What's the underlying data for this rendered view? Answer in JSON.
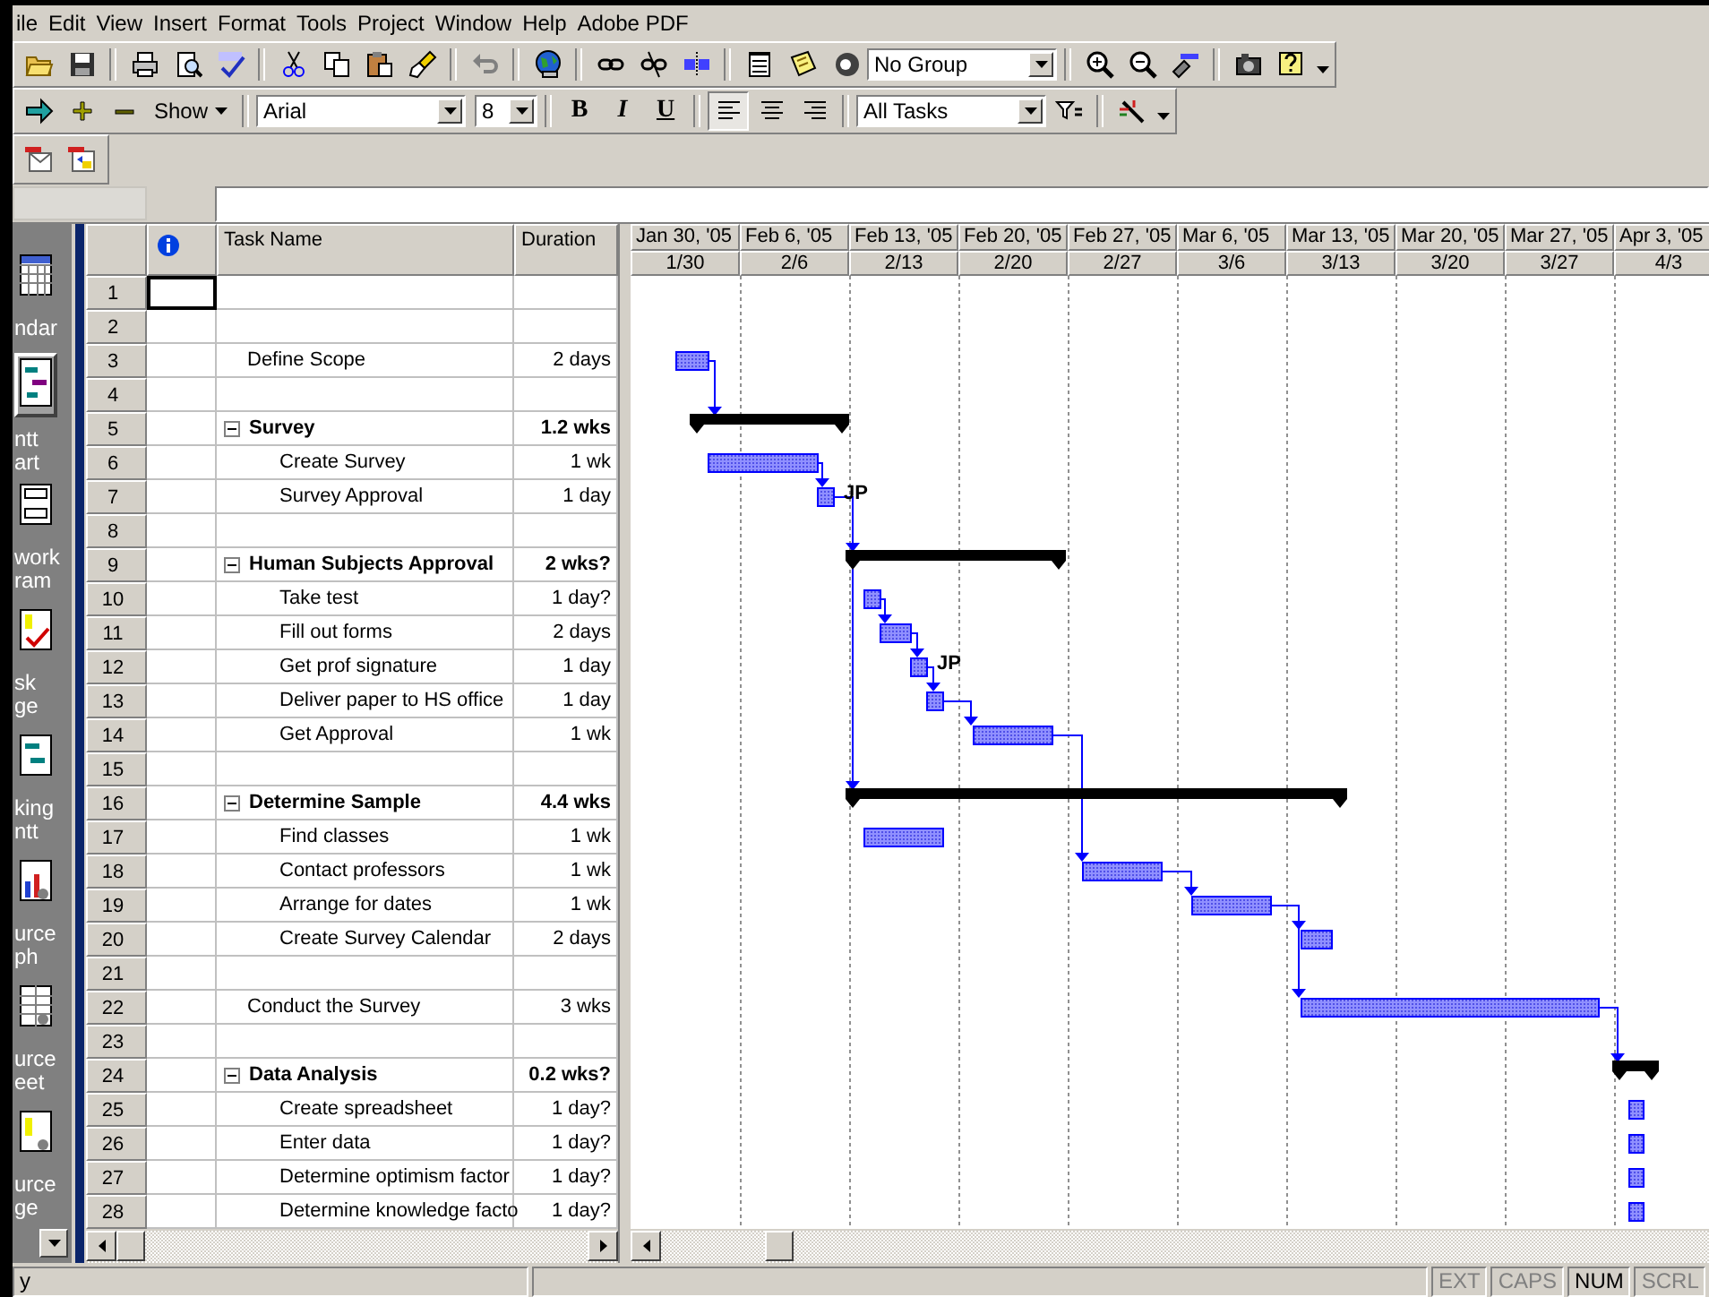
{
  "menu": [
    {
      "label": "ile"
    },
    {
      "label": "Edit"
    },
    {
      "label": "View"
    },
    {
      "label": "Insert"
    },
    {
      "label": "Format"
    },
    {
      "label": "Tools"
    },
    {
      "label": "Project"
    },
    {
      "label": "Window"
    },
    {
      "label": "Help"
    },
    {
      "label": "Adobe PDF"
    }
  ],
  "toolbar": {
    "undo": {
      "disabled": true
    },
    "group_dropdown": {
      "value": "No Group"
    },
    "show_button": {
      "label": "Show"
    },
    "font_dropdown": {
      "value": "Arial"
    },
    "size_dropdown": {
      "value": "8"
    },
    "style_buttons": [
      {
        "label": "B",
        "on": false
      },
      {
        "label": "I",
        "on": false
      },
      {
        "label": "U",
        "on": false
      }
    ],
    "align_buttons": [
      {
        "selected": true
      },
      {
        "selected": false
      },
      {
        "selected": false
      }
    ],
    "filter_dropdown": {
      "value": "All Tasks"
    }
  },
  "view_bar": {
    "items": [
      {
        "lines": [
          "ndar"
        ],
        "selected": false
      },
      {
        "lines": [
          "ntt",
          "art"
        ],
        "selected": true
      },
      {
        "lines": [
          "work",
          "ram"
        ],
        "selected": false
      },
      {
        "lines": [
          "sk",
          "ge"
        ],
        "selected": false
      },
      {
        "lines": [
          "king",
          "ntt"
        ],
        "selected": false
      },
      {
        "lines": [
          "urce",
          "ph"
        ],
        "selected": false
      },
      {
        "lines": [
          "urce",
          "eet"
        ],
        "selected": false
      },
      {
        "lines": [
          "urce",
          "ge"
        ],
        "selected": false
      }
    ]
  },
  "table": {
    "columns": [
      {
        "kind": "indicator"
      },
      {
        "kind": "text",
        "label": "Task Name"
      },
      {
        "kind": "text",
        "label": "Duration"
      }
    ],
    "rows": [
      {
        "row_number": "1",
        "kind": "blank",
        "selected": true
      },
      {
        "row_number": "2",
        "kind": "blank",
        "selected": false
      },
      {
        "row_number": "3",
        "kind": "task",
        "name": "Define Scope",
        "duration": "2 days",
        "selected": false
      },
      {
        "row_number": "4",
        "kind": "blank",
        "selected": false
      },
      {
        "row_number": "5",
        "kind": "summary",
        "name": "Survey",
        "duration": "1.2 wks",
        "expanded": true,
        "selected": false,
        "children": [
          {
            "row_number": "6",
            "kind": "task",
            "name": "Create Survey",
            "duration": "1 wk",
            "selected": false
          },
          {
            "row_number": "7",
            "kind": "task",
            "name": "Survey Approval",
            "duration": "1 day",
            "resource": "JP",
            "selected": false
          }
        ]
      },
      {
        "row_number": "8",
        "kind": "blank",
        "selected": false
      },
      {
        "row_number": "9",
        "kind": "summary",
        "name": "Human Subjects Approval",
        "duration": "2 wks?",
        "expanded": true,
        "selected": false,
        "children": [
          {
            "row_number": "10",
            "kind": "task",
            "name": "Take test",
            "duration": "1 day?",
            "selected": false
          },
          {
            "row_number": "11",
            "kind": "task",
            "name": "Fill out forms",
            "duration": "2 days",
            "selected": false
          },
          {
            "row_number": "12",
            "kind": "task",
            "name": "Get prof signature",
            "duration": "1 day",
            "resource": "JP",
            "selected": false
          },
          {
            "row_number": "13",
            "kind": "task",
            "name": "Deliver paper to HS office",
            "duration": "1 day",
            "selected": false
          },
          {
            "row_number": "14",
            "kind": "task",
            "name": "Get Approval",
            "duration": "1 wk",
            "selected": false
          }
        ]
      },
      {
        "row_number": "15",
        "kind": "blank",
        "selected": false
      },
      {
        "row_number": "16",
        "kind": "summary",
        "name": "Determine Sample",
        "duration": "4.4 wks",
        "expanded": true,
        "selected": false,
        "children": [
          {
            "row_number": "17",
            "kind": "task",
            "name": "Find classes",
            "duration": "1 wk",
            "selected": false
          },
          {
            "row_number": "18",
            "kind": "task",
            "name": "Contact professors",
            "duration": "1 wk",
            "selected": false
          },
          {
            "row_number": "19",
            "kind": "task",
            "name": "Arrange for dates",
            "duration": "1 wk",
            "selected": false
          },
          {
            "row_number": "20",
            "kind": "task",
            "name": "Create Survey Calendar",
            "duration": "2 days",
            "selected": false
          }
        ]
      },
      {
        "row_number": "21",
        "kind": "blank",
        "selected": false
      },
      {
        "row_number": "22",
        "kind": "task",
        "name": "Conduct the Survey",
        "duration": "3 wks",
        "selected": false
      },
      {
        "row_number": "23",
        "kind": "blank",
        "selected": false
      },
      {
        "row_number": "24",
        "kind": "summary",
        "name": "Data Analysis",
        "duration": "0.2 wks?",
        "expanded": true,
        "selected": false,
        "children": [
          {
            "row_number": "25",
            "kind": "task",
            "name": "Create spreadsheet",
            "duration": "1 day?",
            "selected": false
          },
          {
            "row_number": "26",
            "kind": "task",
            "name": "Enter data",
            "duration": "1 day?",
            "selected": false
          },
          {
            "row_number": "27",
            "kind": "task",
            "name": "Determine optimism factor",
            "duration": "1 day?",
            "selected": false
          },
          {
            "row_number": "28",
            "kind": "task",
            "name": "Determine knowledge facto",
            "duration": "1 day?",
            "selected": false
          }
        ]
      }
    ]
  },
  "timescale": [
    {
      "top": "Jan 30, '05",
      "bottom": "1/30"
    },
    {
      "top": "Feb 6, '05",
      "bottom": "2/6"
    },
    {
      "top": "Feb 13, '05",
      "bottom": "2/13"
    },
    {
      "top": "Feb 20, '05",
      "bottom": "2/20"
    },
    {
      "top": "Feb 27, '05",
      "bottom": "2/27"
    },
    {
      "top": "Mar 6, '05",
      "bottom": "3/6"
    },
    {
      "top": "Mar 13, '05",
      "bottom": "3/13"
    },
    {
      "top": "Mar 20, '05",
      "bottom": "3/20"
    },
    {
      "top": "Mar 27, '05",
      "bottom": "3/27"
    },
    {
      "top": "Apr 3, '05",
      "bottom": "4/3"
    }
  ],
  "status_bar": {
    "message": "y",
    "indicators": [
      {
        "label": "EXT",
        "on": false
      },
      {
        "label": "CAPS",
        "on": false
      },
      {
        "label": "NUM",
        "on": true
      },
      {
        "label": "SCRL",
        "on": false
      }
    ]
  }
}
